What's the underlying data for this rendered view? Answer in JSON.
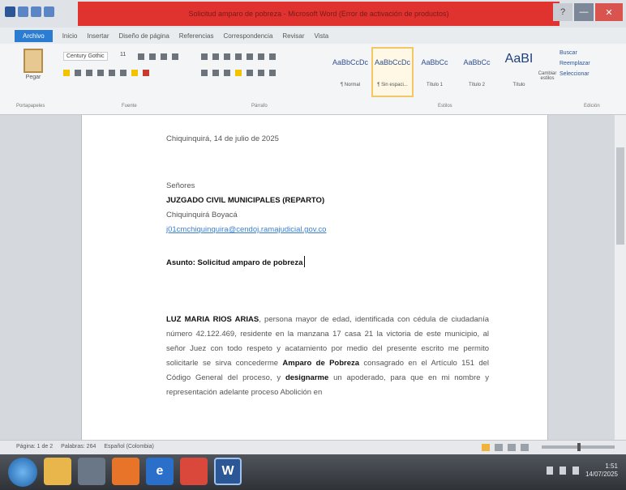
{
  "window": {
    "title": "Solicitud amparo de pobreza - Microsoft Word (Error de activación de productos)",
    "help_glyph": "?",
    "min_glyph": "—",
    "close_glyph": "✕"
  },
  "tabs": [
    "Archivo",
    "Inicio",
    "Insertar",
    "Diseño de página",
    "Referencias",
    "Correspondencia",
    "Revisar",
    "Vista"
  ],
  "ribbon": {
    "paste_label": "Pegar",
    "font_name": "Century Gothic",
    "font_size": "11",
    "styles": [
      {
        "sample": "AaBbCcDc",
        "name": "¶ Normal",
        "selected": false
      },
      {
        "sample": "AaBbCcDc",
        "name": "¶ Sin espaci...",
        "selected": true
      },
      {
        "sample": "AaBbCc",
        "name": "Título 1",
        "selected": false
      },
      {
        "sample": "AaBbCc",
        "name": "Título 2",
        "selected": false
      },
      {
        "sample": "AaBI",
        "name": "Título",
        "selected": false
      }
    ],
    "change_styles": "Cambiar estilos",
    "editing": [
      "Buscar",
      "Reemplazar",
      "Seleccionar"
    ],
    "groups": [
      "Portapapeles",
      "Fuente",
      "Párrafo",
      "Estilos",
      "Edición"
    ]
  },
  "document": {
    "date_line": "Chiquinquirá, 14 de julio de 2025",
    "salutation": "Señores",
    "recipient": "JUZGADO CIVIL MUNICIPALES (REPARTO)",
    "city": "Chiquinquirá Boyacá",
    "email": "j01cmchiquinquira@cendoj.ramajudicial.gov.co",
    "subject": "Asunto: Solicitud amparo de pobreza",
    "body_name": "LUZ MARIA RIOS ARIAS",
    "body_1": ", persona mayor de edad, identificada con cédula de ciudadanía número 42.122.469, residente en la manzana 17 casa 21 la victoria de este municipio, al señor Juez con todo respeto y acatamiento por medio del presente escrito me permito solicitarle se sirva concederme ",
    "body_bold_1": "Amparo de Pobreza",
    "body_2": " consagrado en el Artículo 151 del Código General del proceso, y ",
    "body_bold_2": "designarme",
    "body_3": " un apoderado, para que en mi nombre y representación adelante proceso Abolición en"
  },
  "status": {
    "page": "Página: 1 de 2",
    "words": "Palabras: 264",
    "language": "Español (Colombia)"
  },
  "taskbar": {
    "time": "1:51",
    "date": "14/07/2025"
  },
  "colors": {
    "title_bar_red": "#e0332f",
    "file_tab": "#2b7cd3",
    "link": "#3b7fd0"
  }
}
